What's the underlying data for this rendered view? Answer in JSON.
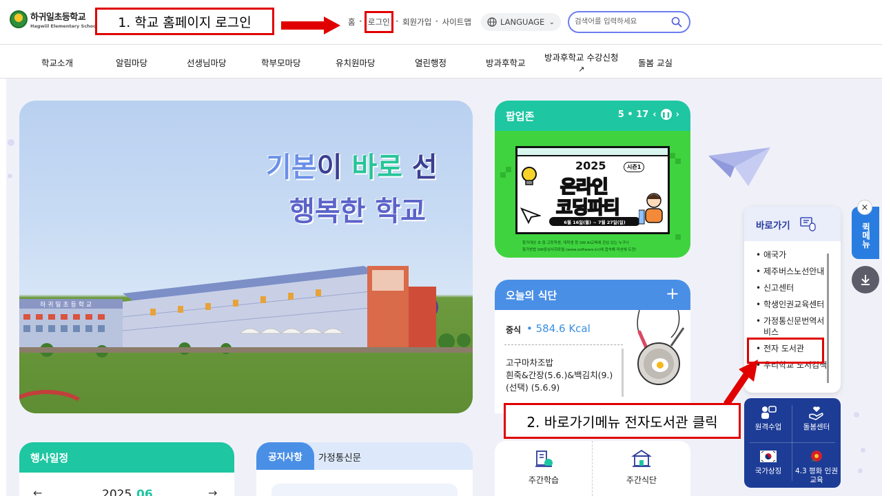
{
  "header": {
    "school_name_ko": "하귀일초등학교",
    "school_name_en": "Hagwiil Elementary School",
    "util_links": [
      "홈",
      "로그인",
      "회원가입",
      "사이트맵"
    ],
    "language_label": "LANGUAGE",
    "search_placeholder": "검색어를 입력하세요"
  },
  "annotations": {
    "step1": "1. 학교 홈페이지 로그인",
    "step2": "2. 바로가기메뉴 전자도서관 클릭"
  },
  "nav": {
    "items": [
      "학교소개",
      "알림마당",
      "선생님마당",
      "학부모마당",
      "유치원마당",
      "열린행정",
      "방과후학교",
      "방과후학교 수강신청",
      "돌봄 교실"
    ]
  },
  "hero": {
    "line1_a": "기본",
    "line1_b": "이 ",
    "line1_c": "바로",
    "line1_d": " 선",
    "line2": "행복한 학교",
    "school_sign": "하 귀 일 초 등 학 교"
  },
  "popup": {
    "title": "팝업존",
    "counter": "5 • 17",
    "banner": {
      "year": "2025",
      "season": "시즌1",
      "title1": "온라인",
      "title2": "코딩파티",
      "date": "6월 16일(월) ~ 7월 27일(일)",
      "foot1": "참가대상   초·중·고등학생, 대학생 등 SW·AI교육에 관심 있는 누구나",
      "foot2": "참가방법   SW중심사회포털 (www.software.kr)에 접속해 미션에 도전!"
    }
  },
  "meal": {
    "title": "오늘의 식단",
    "kind": "중식",
    "kcal": "• 584.6 Kcal",
    "menu_1": "고구마차조밥",
    "menu_2": "흰죽&간장(5.6.)&백김치(9.)",
    "menu_3": "(선택) (5.6.9)"
  },
  "quick_menu": {
    "title": "바로가기",
    "items": [
      "애국가",
      "제주버스노선안내",
      "신고센터",
      "학생인권교육센터",
      "가정통신문번역서비스",
      "전자 도서관",
      "우리학교 도서검색"
    ],
    "grid": [
      "원격수업",
      "돌봄센터",
      "국가상징",
      "4.3 평화 인권교육"
    ],
    "side_tab": "퀵메뉴"
  },
  "schedule": {
    "title": "행사일정",
    "year": "2025",
    "month": "06"
  },
  "notice": {
    "tab_active": "공지사항",
    "tab_other": "가정통신문"
  },
  "services": {
    "items": [
      "주간학습",
      "주간식단"
    ]
  },
  "colors": {
    "accent_green": "#1ec6a2",
    "accent_blue": "#4a8fe6",
    "callout_red": "#e00000",
    "quick_navy": "#1d3c96"
  }
}
